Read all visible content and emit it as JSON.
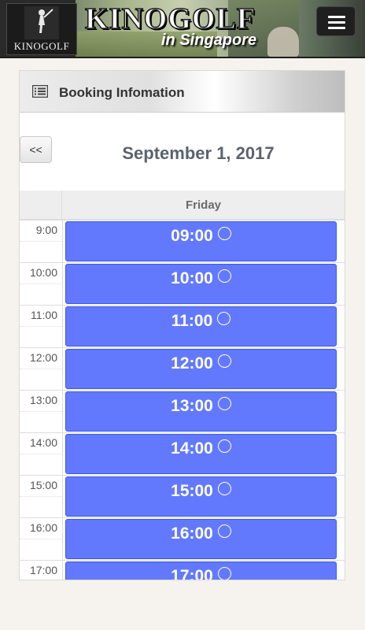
{
  "header": {
    "logo_text": "KINOGOLF",
    "title": "KINOGOLF",
    "subtitle": "in Singapore"
  },
  "menu": {
    "icon": "hamburger-icon"
  },
  "card": {
    "icon": "list-icon",
    "title": "Booking Infomation",
    "prev_label": "<<",
    "date": "September 1, 2017",
    "day_header": "Friday"
  },
  "times": [
    "9:00",
    "10:00",
    "11:00",
    "12:00",
    "13:00",
    "14:00",
    "15:00",
    "16:00",
    "17:00"
  ],
  "slots": [
    {
      "time": "09:00",
      "status_icon": "circle-icon",
      "color": "#6379fd"
    },
    {
      "time": "10:00",
      "status_icon": "circle-icon",
      "color": "#6379fd"
    },
    {
      "time": "11:00",
      "status_icon": "circle-icon",
      "color": "#6379fd"
    },
    {
      "time": "12:00",
      "status_icon": "circle-icon",
      "color": "#6379fd"
    },
    {
      "time": "13:00",
      "status_icon": "circle-icon",
      "color": "#6379fd"
    },
    {
      "time": "14:00",
      "status_icon": "circle-icon",
      "color": "#6379fd"
    },
    {
      "time": "15:00",
      "status_icon": "circle-icon",
      "color": "#6379fd"
    },
    {
      "time": "16:00",
      "status_icon": "circle-icon",
      "color": "#6379fd"
    },
    {
      "time": "17:00",
      "status_icon": "circle-icon",
      "color": "#6379fd"
    }
  ]
}
